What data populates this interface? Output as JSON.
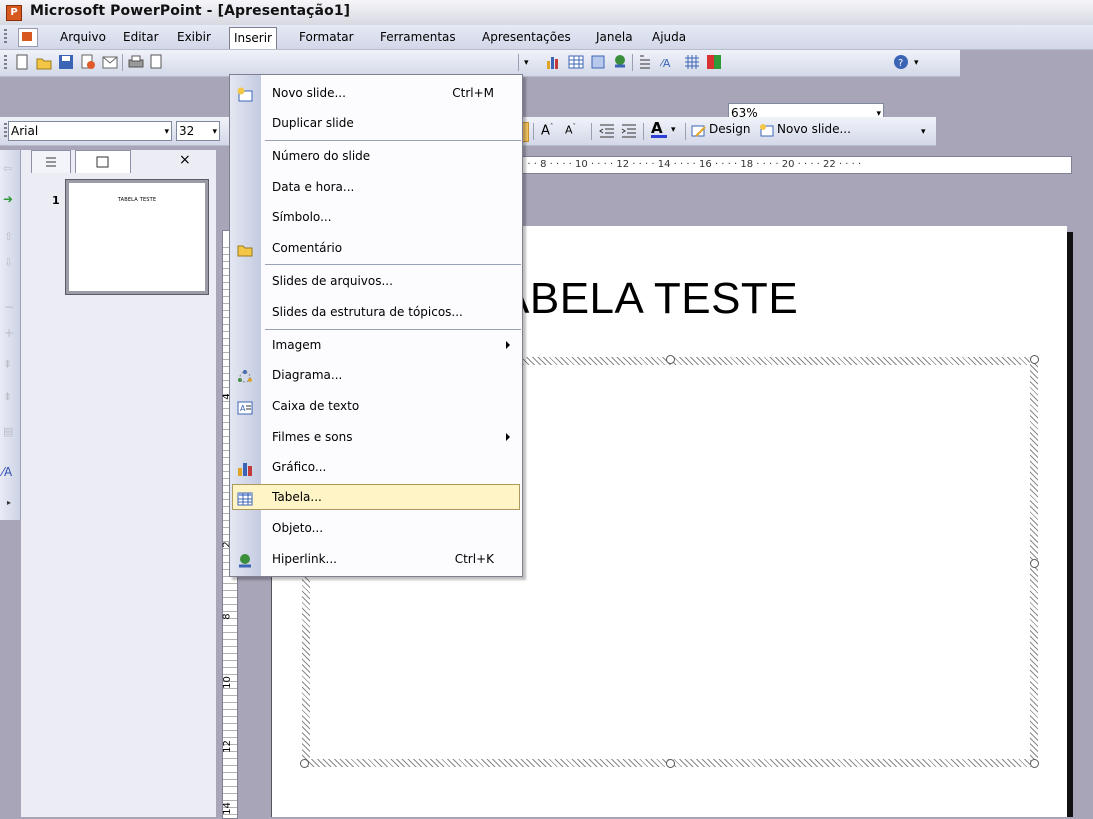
{
  "window": {
    "title": "Microsoft PowerPoint - [Apresentação1]"
  },
  "menubar": {
    "items": [
      {
        "label": "Arquivo"
      },
      {
        "label": "Editar"
      },
      {
        "label": "Exibir"
      },
      {
        "label": "Inserir"
      },
      {
        "label": "Formatar"
      },
      {
        "label": "Ferramentas"
      },
      {
        "label": "Apresentações"
      },
      {
        "label": "Janela"
      },
      {
        "label": "Ajuda"
      }
    ]
  },
  "toolbar_standard": {
    "zoom": "63%"
  },
  "toolbar_format": {
    "font": "Arial",
    "size": "32",
    "design_label": "Design",
    "new_slide_label": "Novo slide..."
  },
  "outline_pane": {
    "slide_number": "1",
    "thumb_title": "TABELA TESTE",
    "close": "×"
  },
  "ruler": {
    "labels": "· · · 8 · · · · 10 · · · · 12 · · · · 14 · · · · 16 · · · · 18 · · · · 20 · · · · 22 · · · ·"
  },
  "vruler": {
    "labels": [
      "4",
      "2",
      "8",
      "10",
      "12",
      "14"
    ]
  },
  "slide": {
    "title": "ABELA TESTE"
  },
  "dropdown": {
    "items": [
      {
        "label": "Novo slide...",
        "shortcut": "Ctrl+M",
        "icon": "new-slide-icon"
      },
      {
        "label": "Duplicar slide"
      },
      {
        "label": "Número do slide"
      },
      {
        "label": "Data e hora..."
      },
      {
        "label": "Símbolo..."
      },
      {
        "label": "Comentário",
        "icon": "comment-icon"
      },
      {
        "label": "Slides de arquivos..."
      },
      {
        "label": "Slides da estrutura de tópicos..."
      },
      {
        "label": "Imagem",
        "submenu": true
      },
      {
        "label": "Diagrama...",
        "icon": "diagram-icon"
      },
      {
        "label": "Caixa de texto",
        "icon": "textbox-icon"
      },
      {
        "label": "Filmes e sons",
        "submenu": true
      },
      {
        "label": "Gráfico...",
        "icon": "chart-icon"
      },
      {
        "label": "Tabela...",
        "icon": "table-icon",
        "highlighted": true
      },
      {
        "label": "Objeto..."
      },
      {
        "label": "Hiperlink...",
        "shortcut": "Ctrl+K",
        "icon": "hyperlink-icon"
      }
    ]
  },
  "colors": {
    "menu_highlight": "#fff4c6",
    "app_accent": "#d65a1f"
  }
}
